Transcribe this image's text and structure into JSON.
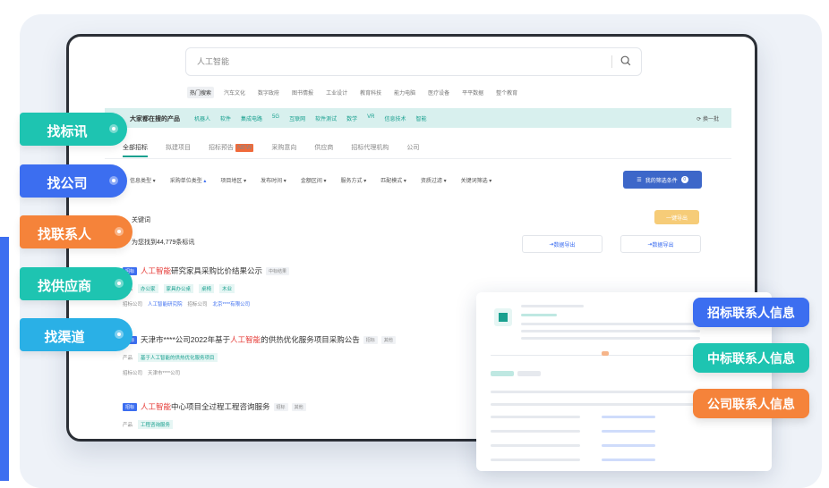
{
  "search": {
    "query": "人工智能"
  },
  "hot_row": [
    "热门搜索",
    "汽车文化",
    "数字政府",
    "图书情报",
    "工业设计",
    "教育科技",
    "能力电脑",
    "医疗设备",
    "平平数据",
    "整个教育"
  ],
  "teal_bar": {
    "label": "大家都在搜的产品",
    "items": [
      "机器人",
      "软件",
      "集成电路",
      "5G",
      "互联网",
      "软件测试",
      "数学",
      "VR",
      "信息技术",
      "智能"
    ],
    "refresh": "换一批"
  },
  "tabs": [
    {
      "label": "全部招标",
      "new": ""
    },
    {
      "label": "拟建项目",
      "new": ""
    },
    {
      "label": "招标预告",
      "new": "NEW"
    },
    {
      "label": "采购意向",
      "new": ""
    },
    {
      "label": "供应商",
      "new": ""
    },
    {
      "label": "招标代理机构",
      "new": ""
    },
    {
      "label": "公司",
      "new": ""
    }
  ],
  "filters": [
    "信息类型",
    "采购单位类型",
    "项目地区",
    "发布时间",
    "金额区间",
    "服务方式",
    "匹配模式",
    "资质过滤",
    "关键词筛选"
  ],
  "saved_filter": {
    "label": "我的筛选条件",
    "count": "0"
  },
  "keyword_label": "关键词",
  "orange_btn": "一键导出",
  "count_text": "为您找到44,779条标讯",
  "exports": [
    "数据导出",
    "数据导出"
  ],
  "results": [
    {
      "tag": "招标",
      "pre": "",
      "highlight": "人工智能",
      "post": "研究家具采购比价结果公示",
      "badges": [
        "中标结果"
      ],
      "meta_label": "产品",
      "chips": [
        "办公家",
        "家具办公桌",
        "桌椅",
        "木业"
      ],
      "company_label": "招标公司",
      "company": "人工智能研究院",
      "agent_label": "招标公司",
      "agent": "北京****有限公司"
    },
    {
      "tag": "招标",
      "pre": "天津市****公司2022年基于",
      "highlight": "人工智能",
      "post": "的供热优化服务项目采购公告",
      "badges": [
        "招标",
        "其他"
      ],
      "meta_label": "产品",
      "chips": [
        "基于人工智能的供热优化服务项目"
      ],
      "company_label": "招标公司",
      "company": "天津市****公司",
      "agent_label": "",
      "agent": ""
    },
    {
      "tag": "招标",
      "pre": "",
      "highlight": "人工智能",
      "post": "中心项目全过程工程咨询服务",
      "badges": [
        "招标",
        "其他"
      ],
      "meta_label": "产品",
      "chips": [
        "工程咨询服务"
      ],
      "company_label": "",
      "company": "",
      "agent_label": "",
      "agent": ""
    }
  ],
  "side_pills": [
    {
      "label": "找标讯",
      "color": "#1ec4b1"
    },
    {
      "label": "找公司",
      "color": "#3c6ef0"
    },
    {
      "label": "找联系人",
      "color": "#f5833a"
    },
    {
      "label": "找供应商",
      "color": "#1ec4b1"
    },
    {
      "label": "找渠道",
      "color": "#2ab0e6"
    }
  ],
  "right_tags": [
    {
      "label": "招标联系人信息",
      "color": "#3c6ef0"
    },
    {
      "label": "中标联系人信息",
      "color": "#1ec4b1"
    },
    {
      "label": "公司联系人信息",
      "color": "#f5833a"
    }
  ],
  "colors": {
    "accent": "#19a08f",
    "brand_blue": "#3c6ef0",
    "highlight_red": "#e53935"
  }
}
